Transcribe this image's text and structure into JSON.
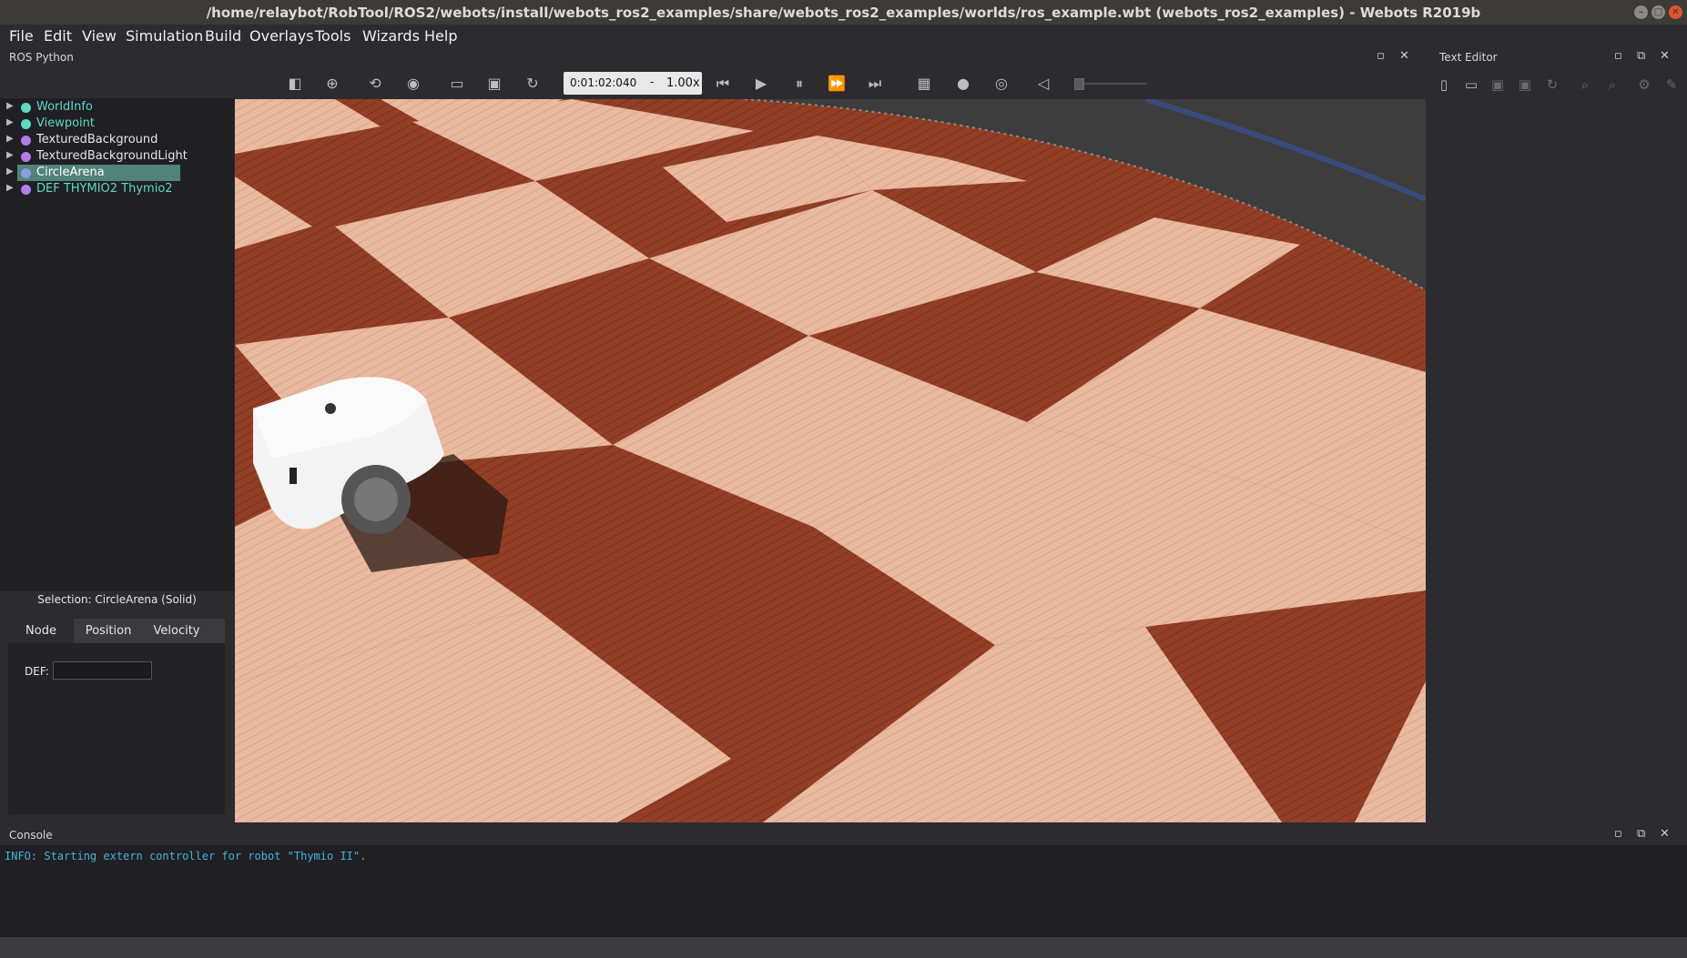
{
  "window": {
    "title": "/home/relaybot/RobTool/ROS2/webots/install/webots_ros2_examples/share/webots_ros2_examples/worlds/ros_example.wbt (webots_ros2_examples) - Webots R2019b"
  },
  "menu": [
    "File",
    "Edit",
    "View",
    "Simulation",
    "Build",
    "Overlays",
    "Tools",
    "Wizards",
    "Help"
  ],
  "ros_panel": {
    "title": "ROS Python"
  },
  "toolbar": {
    "time": "0:01:02:040",
    "time_sep": "-",
    "speed": "1.00x"
  },
  "scene_tree": [
    {
      "label": "WorldInfo",
      "color": "#5ed9c8",
      "dot": "#5ed9c8"
    },
    {
      "label": "Viewpoint",
      "color": "#5ed9c8",
      "dot": "#5ed9c8"
    },
    {
      "label": "TexturedBackground",
      "color": "#e6e6e6",
      "dot": "#b07ee8"
    },
    {
      "label": "TexturedBackgroundLight",
      "color": "#e6e6e6",
      "dot": "#b07ee8"
    },
    {
      "label": "CircleArena",
      "color": "#ffffff",
      "dot": "#8aa0d8"
    },
    {
      "label": "DEF THYMIO2 Thymio2",
      "color": "#5ed9c8",
      "dot": "#b07ee8"
    }
  ],
  "selection": {
    "label": "Selection: CircleArena (Solid)",
    "tabs": [
      "Node",
      "Position",
      "Velocity"
    ],
    "def_label": "DEF:",
    "def_value": ""
  },
  "text_editor": {
    "title": "Text Editor"
  },
  "console": {
    "title": "Console",
    "lines": [
      "INFO: Starting extern controller for robot \"Thymio II\"."
    ]
  }
}
